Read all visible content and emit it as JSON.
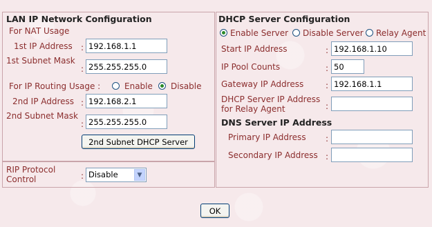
{
  "lan": {
    "title": "LAN IP Network Configuration",
    "nat_usage_label": "For NAT Usage",
    "ip1_label": "1st IP Address",
    "ip1_value": "192.168.1.1",
    "mask1_label": "1st Subnet Mask",
    "mask1_value": "255.255.255.0",
    "routing_label": "For IP Routing Usage  :",
    "routing_enable_label": "Enable",
    "routing_disable_label": "Disable",
    "routing_selected": "Disable",
    "ip2_label": "2nd IP Address",
    "ip2_value": "192.168.2.1",
    "mask2_label": "2nd Subnet Mask",
    "mask2_value": "255.255.255.0",
    "dhcp2_button_label": "2nd Subnet DHCP Server"
  },
  "rip": {
    "label": "RIP Protocol Control",
    "selected": "Disable"
  },
  "dhcp": {
    "title": "DHCP Server Configuration",
    "mode_enable_label": "Enable Server",
    "mode_disable_label": "Disable Server",
    "mode_relay_label": "Relay Agent",
    "mode_selected": "Enable Server",
    "start_ip_label": "Start IP Address",
    "start_ip_value": "192.168.1.10",
    "pool_label": "IP Pool Counts",
    "pool_value": "50",
    "gateway_label": "Gateway IP Address",
    "gateway_value": "192.168.1.1",
    "relay_ip_label": "DHCP Server IP Address for Relay Agent",
    "relay_ip_value": "",
    "dns_title": "DNS Server IP Address",
    "dns_primary_label": "Primary IP Address",
    "dns_primary_value": "",
    "dns_secondary_label": "Secondary IP Address",
    "dns_secondary_value": ""
  },
  "footer": {
    "ok_label": "OK"
  },
  "colors": {
    "background": "#f6e9eb",
    "label": "#8b2d2d",
    "header": "#222222",
    "border": "#c9a4aa"
  }
}
